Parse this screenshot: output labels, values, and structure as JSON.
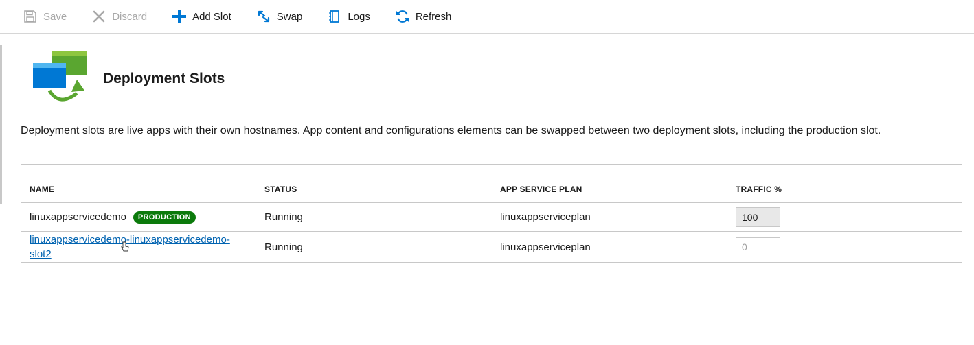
{
  "toolbar": {
    "save_label": "Save",
    "discard_label": "Discard",
    "add_slot_label": "Add Slot",
    "swap_label": "Swap",
    "logs_label": "Logs",
    "refresh_label": "Refresh"
  },
  "header": {
    "title": "Deployment Slots",
    "icon": "deployment-slots-icon"
  },
  "description": "Deployment slots are live apps with their own hostnames. App content and configurations elements can be swapped between two deployment slots, including the production slot.",
  "table": {
    "columns": [
      "NAME",
      "STATUS",
      "APP SERVICE PLAN",
      "TRAFFIC %"
    ],
    "rows": [
      {
        "name": "linuxappservicedemo",
        "badge": "PRODUCTION",
        "status": "Running",
        "plan": "linuxappserviceplan",
        "traffic": "100"
      },
      {
        "name": "linuxappservicedemo-linuxappservicedemo-slot2",
        "status": "Running",
        "plan": "linuxappserviceplan",
        "traffic_placeholder": "0"
      }
    ]
  },
  "colors": {
    "accent": "#0063b1",
    "badge_bg": "#0b7a0b",
    "disabled_text": "#a8a8a8",
    "icon_blue": "#0078d4",
    "icon_green": "#5aa630"
  }
}
